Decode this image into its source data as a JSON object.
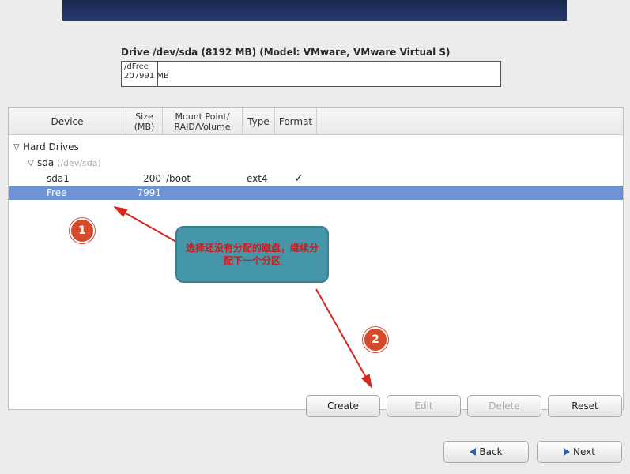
{
  "drive": {
    "title": "Drive /dev/sda (8192 MB) (Model: VMware, VMware Virtual S)",
    "seg1_line1": "/d",
    "seg2_line1": "Free",
    "seg1_line2": "20",
    "seg2_line2": "7991 MB"
  },
  "headers": {
    "device": "Device",
    "size": "Size\n(MB)",
    "mount": "Mount Point/\nRAID/Volume",
    "type": "Type",
    "format": "Format"
  },
  "tree": {
    "hard_drives": "Hard Drives",
    "sda": "sda",
    "sda_sub": "(/dev/sda)",
    "row1": {
      "device": "sda1",
      "size": "200",
      "mount": "/boot",
      "type": "ext4",
      "format": "✓"
    },
    "row2": {
      "device": "Free",
      "size": "7991"
    }
  },
  "buttons": {
    "create": "Create",
    "edit": "Edit",
    "delete": "Delete",
    "reset": "Reset",
    "back": "Back",
    "next": "Next"
  },
  "annotation": {
    "bubble": "选择还没有分配的磁盘，继续分配下一个分区",
    "num1": "1",
    "num2": "2"
  }
}
